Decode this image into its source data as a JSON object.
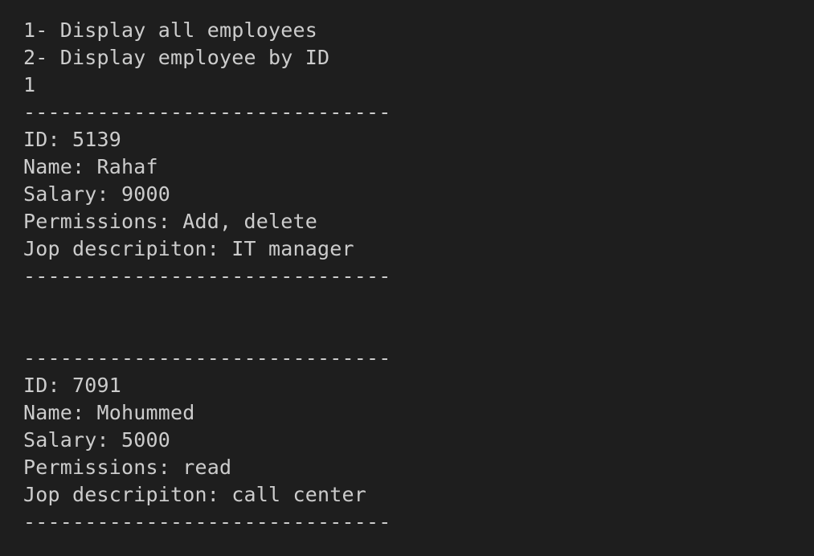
{
  "terminal": {
    "menu": {
      "option_1": "1- Display all employees",
      "option_2": "2- Display employee by ID",
      "input": "1"
    },
    "separator": "------------------------------",
    "employees": [
      {
        "id": "ID: 5139",
        "name": "Name: Rahaf",
        "salary": "Salary: 9000",
        "permissions": "Permissions: Add, delete",
        "job": "Jop descripiton: IT manager"
      },
      {
        "id": "ID: 7091",
        "name": "Name: Mohummed",
        "salary": "Salary: 5000",
        "permissions": "Permissions: read",
        "job": "Jop descripiton: call center"
      }
    ]
  }
}
